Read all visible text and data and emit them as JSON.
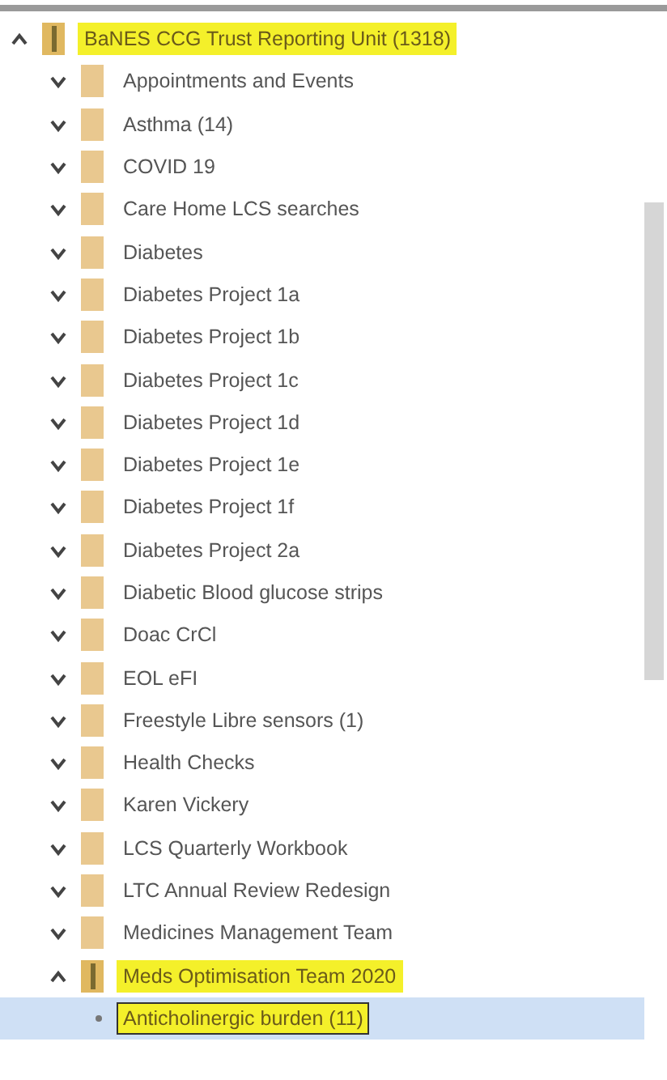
{
  "tree": {
    "label": "BaNES CCG Trust Reporting Unit (1318)",
    "kind": "shared-folder",
    "expanded": true,
    "highlighted": true,
    "selected": false,
    "children": [
      {
        "label": "Appointments and Events",
        "kind": "folder",
        "expanded": false,
        "highlighted": false,
        "selected": false
      },
      {
        "label": "Asthma (14)",
        "kind": "folder",
        "expanded": false,
        "highlighted": false,
        "selected": false
      },
      {
        "label": "COVID 19",
        "kind": "folder",
        "expanded": false,
        "highlighted": false,
        "selected": false
      },
      {
        "label": "Care Home LCS searches",
        "kind": "folder",
        "expanded": false,
        "highlighted": false,
        "selected": false
      },
      {
        "label": "Diabetes",
        "kind": "folder",
        "expanded": false,
        "highlighted": false,
        "selected": false
      },
      {
        "label": "Diabetes Project 1a",
        "kind": "folder",
        "expanded": false,
        "highlighted": false,
        "selected": false
      },
      {
        "label": "Diabetes Project 1b",
        "kind": "folder",
        "expanded": false,
        "highlighted": false,
        "selected": false
      },
      {
        "label": "Diabetes Project 1c",
        "kind": "folder",
        "expanded": false,
        "highlighted": false,
        "selected": false
      },
      {
        "label": "Diabetes Project 1d",
        "kind": "folder",
        "expanded": false,
        "highlighted": false,
        "selected": false
      },
      {
        "label": "Diabetes Project 1e",
        "kind": "folder",
        "expanded": false,
        "highlighted": false,
        "selected": false
      },
      {
        "label": "Diabetes Project 1f",
        "kind": "folder",
        "expanded": false,
        "highlighted": false,
        "selected": false
      },
      {
        "label": "Diabetes Project 2a",
        "kind": "folder",
        "expanded": false,
        "highlighted": false,
        "selected": false
      },
      {
        "label": "Diabetic Blood glucose strips",
        "kind": "folder",
        "expanded": false,
        "highlighted": false,
        "selected": false
      },
      {
        "label": "Doac CrCl",
        "kind": "folder",
        "expanded": false,
        "highlighted": false,
        "selected": false
      },
      {
        "label": "EOL eFI",
        "kind": "folder",
        "expanded": false,
        "highlighted": false,
        "selected": false
      },
      {
        "label": "Freestyle Libre sensors (1)",
        "kind": "folder",
        "expanded": false,
        "highlighted": false,
        "selected": false
      },
      {
        "label": "Health Checks",
        "kind": "folder",
        "expanded": false,
        "highlighted": false,
        "selected": false
      },
      {
        "label": "Karen Vickery",
        "kind": "folder",
        "expanded": false,
        "highlighted": false,
        "selected": false
      },
      {
        "label": "LCS Quarterly Workbook",
        "kind": "folder",
        "expanded": false,
        "highlighted": false,
        "selected": false
      },
      {
        "label": "LTC Annual Review Redesign",
        "kind": "folder",
        "expanded": false,
        "highlighted": false,
        "selected": false
      },
      {
        "label": "Medicines Management Team",
        "kind": "folder",
        "expanded": false,
        "highlighted": false,
        "selected": false
      },
      {
        "label": "Meds Optimisation Team 2020",
        "kind": "shared-folder",
        "expanded": true,
        "highlighted": true,
        "selected": false,
        "children": [
          {
            "label": "Anticholinergic burden (11)",
            "kind": "leaf",
            "highlighted": true,
            "selected": true
          }
        ]
      }
    ]
  }
}
